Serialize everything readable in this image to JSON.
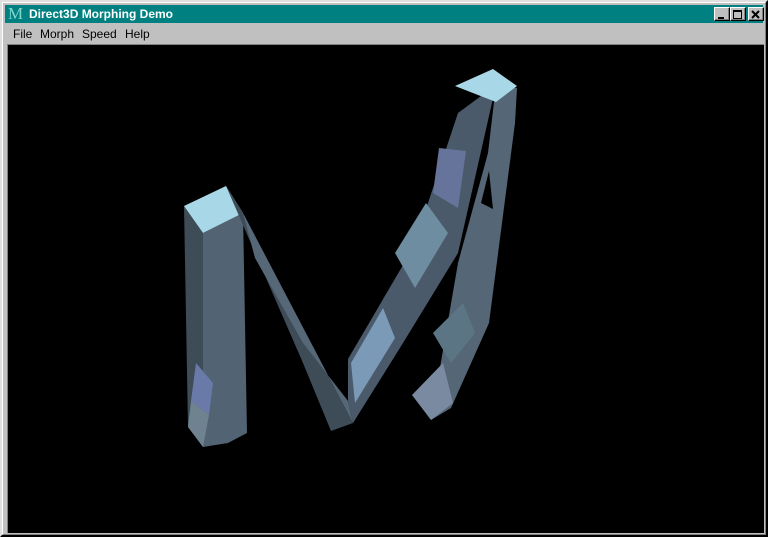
{
  "window": {
    "title": "Direct3D Morphing Demo",
    "icon": "M",
    "controls": {
      "minimize": "minimize-icon",
      "maximize": "maximize-icon",
      "close": "close-icon"
    }
  },
  "menu": {
    "items": [
      {
        "label": "File"
      },
      {
        "label": "Morph"
      },
      {
        "label": "Speed"
      },
      {
        "label": "Help"
      }
    ]
  },
  "colors": {
    "titlebar": "#008080",
    "viewport": "#000000",
    "letter_face": "#526373",
    "letter_top": "#a8d8e8"
  }
}
